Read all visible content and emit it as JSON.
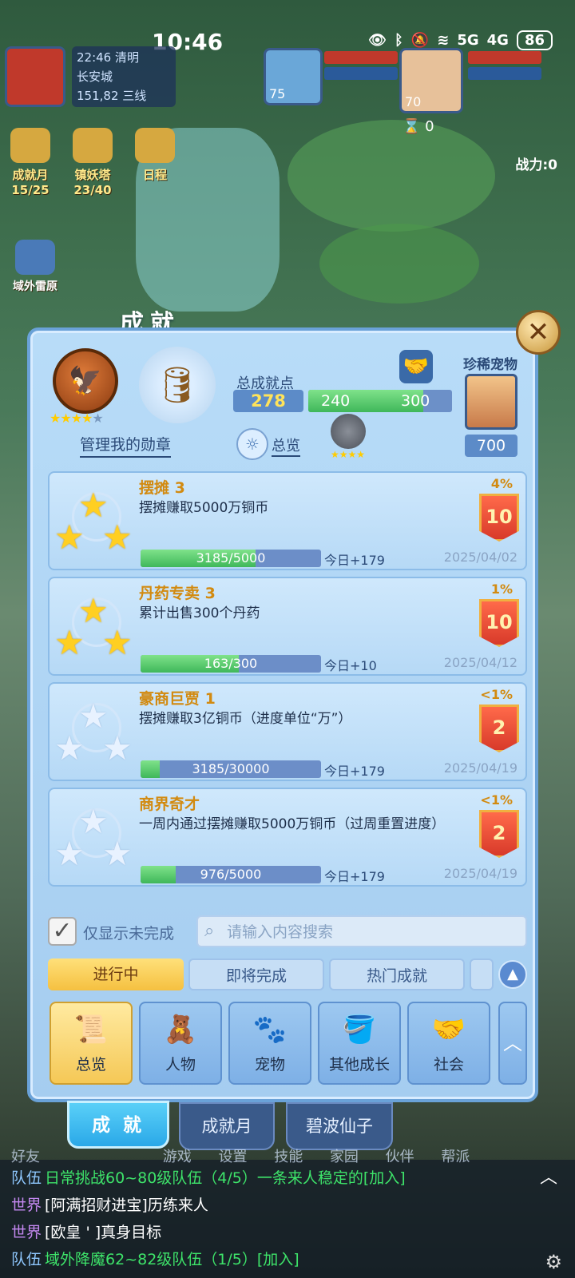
{
  "status_bar": {
    "time": "10:46",
    "signal1": "5G",
    "signal2": "4G",
    "battery": "86"
  },
  "hud": {
    "time": "22:46",
    "weather": "清明",
    "location": "长安城",
    "coords": "151,82",
    "line": "三线",
    "pet_level": "75",
    "char_level": "70",
    "hourglass_count": "0"
  },
  "left_menu": [
    {
      "label": "成就月",
      "progress": "15/25"
    },
    {
      "label": "镇妖塔",
      "progress": "23/40"
    },
    {
      "label": "日程",
      "progress": ""
    }
  ],
  "left_menu2": {
    "label": "域外雷原"
  },
  "power": "战力:0",
  "dialog": {
    "title": "成就",
    "manage_medals": "管理我的勋章",
    "total_points_label": "总成就点",
    "total_points": "278",
    "progress_current": "240",
    "progress_max": "300",
    "progress_fraction": 0.8,
    "overview_label": "总览",
    "rare_pet_label": "珍稀宠物",
    "rare_pet_value": "700"
  },
  "achievements": [
    {
      "title": "摆摊 3",
      "desc": "摆摊赚取5000万铜币",
      "progress": "3185/5000",
      "fraction": 0.637,
      "today": "今日+179",
      "date": "2025/04/02",
      "pct": "4%",
      "reward": "10",
      "stars": 3
    },
    {
      "title": "丹药专卖 3",
      "desc": "累计出售300个丹药",
      "progress": "163/300",
      "fraction": 0.543,
      "today": "今日+10",
      "date": "2025/04/12",
      "pct": "1%",
      "reward": "10",
      "stars": 3
    },
    {
      "title": "豪商巨贾 1",
      "desc": "摆摊赚取3亿铜币（进度单位“万”）",
      "progress": "3185/30000",
      "fraction": 0.106,
      "today": "今日+179",
      "date": "2025/04/19",
      "pct": "<1%",
      "reward": "2",
      "stars": 0
    },
    {
      "title": "商界奇才",
      "desc": "一周内通过摆摊赚取5000万铜币（过周重置进度）",
      "progress": "976/5000",
      "fraction": 0.195,
      "today": "今日+179",
      "date": "2025/04/19",
      "pct": "<1%",
      "reward": "2",
      "stars": 0
    }
  ],
  "filter": {
    "only_unfinished": "仅显示未完成",
    "search_placeholder": "请输入内容搜索",
    "tabs": [
      "进行中",
      "即将完成",
      "热门成就"
    ]
  },
  "categories": [
    {
      "label": "总览",
      "icon": "book-icon"
    },
    {
      "label": "人物",
      "icon": "person-icon"
    },
    {
      "label": "宠物",
      "icon": "paw-icon"
    },
    {
      "label": "其他成长",
      "icon": "bucket-icon"
    },
    {
      "label": "社会",
      "icon": "handshake-icon"
    }
  ],
  "bottom_tabs": [
    "成 就",
    "成就月",
    "碧波仙子"
  ],
  "menu_row": [
    "好友",
    "游戏",
    "设置",
    "技能",
    "家园",
    "伙伴",
    "帮派"
  ],
  "chat": [
    {
      "channel": "队伍",
      "text": "日常挑战60~80级队伍（4/5）一条来人稳定的[加入]"
    },
    {
      "channel": "世界",
      "text": "[阿满招财进宝]历练来人"
    },
    {
      "channel": "世界",
      "text": "[欧皇 ' ]真身目标"
    },
    {
      "channel": "队伍",
      "text": "域外降魔62~82级队伍（1/5）[加入]"
    }
  ],
  "colors": {
    "accent_gold": "#f5c040",
    "panel_blue": "#a5cdf0",
    "progress_green": "#3fb75a",
    "badge_red": "#d83a2a"
  }
}
